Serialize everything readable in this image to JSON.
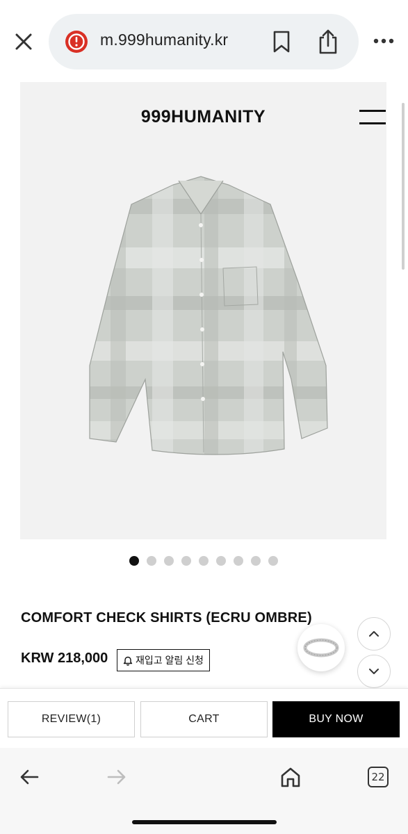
{
  "browser": {
    "url": "m.999humanity.kr",
    "open_tabs": "22",
    "icons": {
      "close": "close-icon",
      "warning": "not-secure-warning-icon",
      "bookmark": "bookmark-icon",
      "share": "share-icon",
      "more": "more-dots-icon",
      "back": "back-arrow-icon",
      "forward": "forward-arrow-icon",
      "home": "home-icon",
      "tabs": "tabs-icon"
    }
  },
  "site": {
    "brand": "999HUMANITY",
    "menu_icon": "hamburger-icon"
  },
  "gallery": {
    "slide_count": 9,
    "active_index": 0
  },
  "product": {
    "title": "COMFORT CHECK SHIRTS (ECRU OMBRE)",
    "price": "KRW 218,000",
    "restock_label": "재입고 알림 신청",
    "restock_icon": "bell-icon"
  },
  "actions": {
    "review_label": "REVIEW(1)",
    "cart_label": "CART",
    "buy_label": "BUY NOW"
  },
  "colors": {
    "warning_red": "#d93025",
    "buy_button_bg": "#000000",
    "hero_bg": "#f2f2f2",
    "shirt_base": "#cdd1cc"
  }
}
